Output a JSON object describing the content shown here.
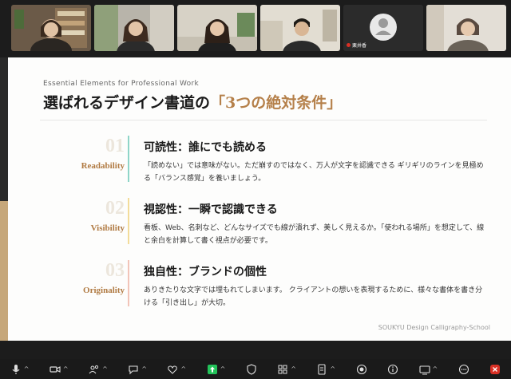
{
  "meeting": {
    "participants": [
      {
        "id": "p1",
        "name": ""
      },
      {
        "id": "p2",
        "name": ""
      },
      {
        "id": "p3",
        "name": ""
      },
      {
        "id": "p4",
        "name": ""
      },
      {
        "id": "p5",
        "name": "栗井香"
      },
      {
        "id": "p6",
        "name": ""
      }
    ]
  },
  "slide": {
    "subtitle": "Essential Elements for Professional Work",
    "title_main": "選ばれるデザイン書道の",
    "title_accent": "「3つの絶対条件」",
    "sections": [
      {
        "number": "01",
        "label": "Readability",
        "title": "可読性：誰にでも読める",
        "description": "「読めない」では意味がない。ただ崩すのではなく、万人が文字を認識できる ギリギリのラインを見極める「バランス感覚」を養いましょう。",
        "bar_color": "#8fd5c8"
      },
      {
        "number": "02",
        "label": "Visibility",
        "title": "視認性：一瞬で認識できる",
        "description": "看板、Web、名刺など、どんなサイズでも線が潰れず、美しく見えるか。「使われる場所」を想定して、線と余白を計算して書く視点が必要です。",
        "bar_color": "#f3dc9a"
      },
      {
        "number": "03",
        "label": "Originality",
        "title": "独自性：ブランドの個性",
        "description": "ありきたりな文字では埋もれてしまいます。 クライアントの想いを表現するために、様々な書体を書き分ける「引き出し」が大切。",
        "bar_color": "#f2c4b8"
      }
    ],
    "footer_brand": "SOUKYU Design Calligraphy-School"
  },
  "toolbar": {
    "items": [
      {
        "icon": "microphone-icon",
        "caret": "^"
      },
      {
        "icon": "camera-icon",
        "caret": "^"
      },
      {
        "icon": "participants-icon",
        "caret": "^"
      },
      {
        "icon": "chat-icon",
        "caret": "^"
      },
      {
        "icon": "reactions-icon",
        "caret": "^"
      },
      {
        "icon": "share-screen-icon",
        "caret": "^"
      },
      {
        "icon": "security-icon",
        "caret": ""
      },
      {
        "icon": "apps-icon",
        "caret": "^"
      },
      {
        "icon": "notes-icon",
        "caret": "^"
      },
      {
        "icon": "record-icon",
        "caret": ""
      },
      {
        "icon": "info-icon",
        "caret": ""
      },
      {
        "icon": "view-icon",
        "caret": "^"
      },
      {
        "icon": "more-icon",
        "caret": ""
      },
      {
        "icon": "leave-icon",
        "caret": ""
      }
    ]
  },
  "colors": {
    "accent": "#b5804a",
    "share_green": "#23c35a",
    "leave_red": "#d93025"
  }
}
